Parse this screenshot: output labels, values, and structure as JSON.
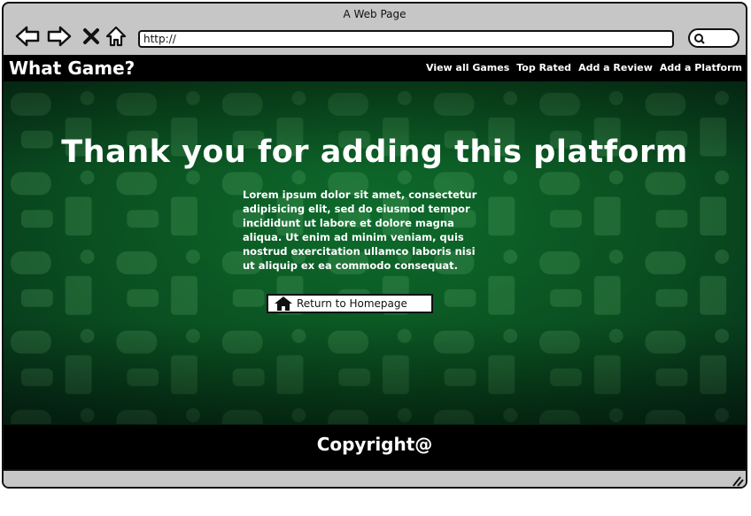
{
  "window": {
    "title": "A Web Page"
  },
  "browser": {
    "url": "http://"
  },
  "site": {
    "logo": "What Game?",
    "nav": [
      "View all Games",
      "Top Rated",
      "Add a Review",
      "Add a Platform"
    ]
  },
  "main": {
    "headline": "Thank you for adding this platform",
    "body": "Lorem ipsum dolor sit amet, consectetur adipisicing elit, sed do eiusmod tempor incididunt ut labore et dolore magna aliqua. Ut enim ad minim veniam, quis nostrud exercitation ullamco laboris nisi ut aliquip ex ea commodo consequat.",
    "return_button": "Return to Homepage"
  },
  "footer": {
    "text": "Copyright@"
  },
  "colors": {
    "hero_green": "#0a4f20",
    "header_bg": "#000000",
    "chrome_gray": "#c6c6c6"
  },
  "icons": [
    "back-arrow-icon",
    "forward-arrow-icon",
    "close-icon",
    "home-icon",
    "search-icon",
    "resize-grip-icon"
  ]
}
